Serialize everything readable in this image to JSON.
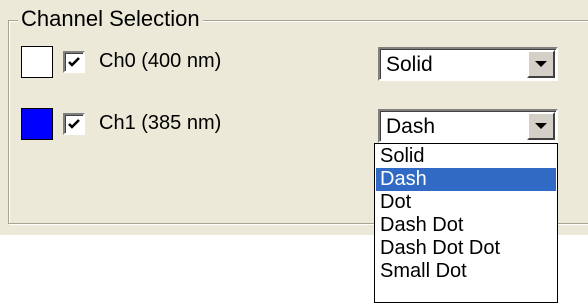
{
  "group": {
    "title": "Channel Selection"
  },
  "channels": [
    {
      "label": "Ch0 (400 nm)",
      "color": "#ffffff",
      "checked": true,
      "line_style": "Solid"
    },
    {
      "label": "Ch1 (385 nm)",
      "color": "#0000ff",
      "checked": true,
      "line_style": "Dash"
    }
  ],
  "dropdown": {
    "options": [
      "Solid",
      "Dash",
      "Dot",
      "Dash Dot",
      "Dash Dot Dot",
      "Small Dot"
    ],
    "highlighted": "Dash"
  },
  "icons": {
    "check": "checkmark-icon",
    "arrow": "chevron-down-icon"
  }
}
